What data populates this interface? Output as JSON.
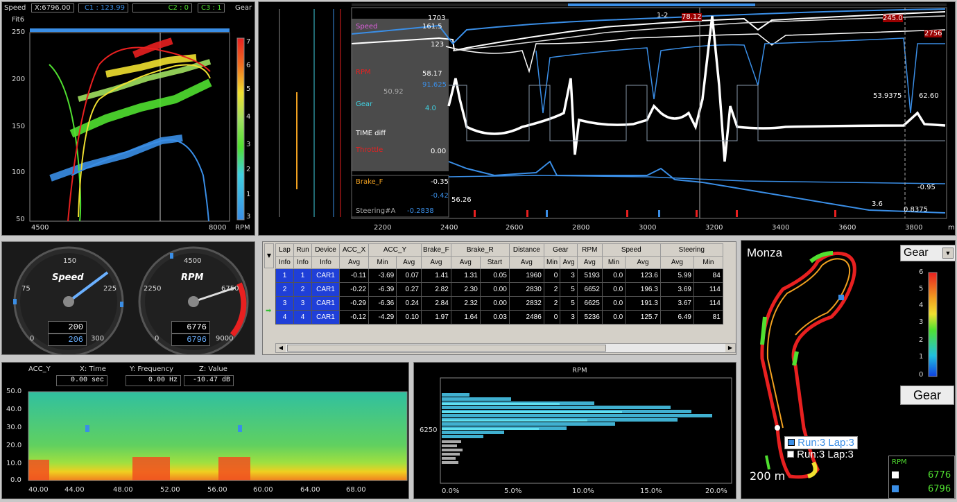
{
  "scatter": {
    "header_speed": "Speed",
    "header_x": "X:6796.00",
    "header_c1": "C1 : 123.99",
    "header_c2": "C2 : 0",
    "header_c3": "C3 : 1",
    "header_gear": "Gear",
    "header_fit": "Fit6",
    "y_ticks": [
      "250",
      "200",
      "150",
      "100",
      "50"
    ],
    "x_ticks": [
      "4500",
      "8000"
    ],
    "x_unit": "RPM",
    "gear_scale": [
      "7",
      "6",
      "5",
      "4",
      "3",
      "2",
      "1",
      "3"
    ]
  },
  "timeplot": {
    "x_ticks": [
      "2200",
      "2400",
      "2600",
      "2800",
      "3000",
      "3200",
      "3400",
      "3600",
      "3800"
    ],
    "x_unit": "m",
    "channel_labels": [
      "Speed",
      "RPM",
      "Gear",
      "TIME diff",
      "Throttle",
      "Brake_F",
      "Steering#A"
    ],
    "values": {
      "v1703": "1703",
      "v1615": "161.5",
      "v123": "123",
      "v5817": "58.17",
      "v91625": "91.625",
      "v5092": "50.92",
      "v40": "4.0",
      "v000": "0.00",
      "brake1": "-0.35",
      "brake2": "-0.42",
      "v5626": "56.26",
      "steer": "-0.2838",
      "marker": "1-2",
      "top1": "78.12",
      "right1": "245.0",
      "right2": "2756",
      "right3": "53.9375",
      "right4": "62.60",
      "right5": "-0.95",
      "right6": "0.8375",
      "right7": "3.6"
    }
  },
  "gauges": {
    "speed_title": "Speed",
    "speed_ticks": [
      "0",
      "75",
      "150",
      "225",
      "300"
    ],
    "speed_val1": "200",
    "speed_val2": "206",
    "rpm_title": "RPM",
    "rpm_ticks": [
      "0",
      "2250",
      "4500",
      "6750",
      "9000"
    ],
    "rpm_val1": "6776",
    "rpm_val2": "6796"
  },
  "table": {
    "headers1": [
      "Lap",
      "Run",
      "Device",
      "ACC_X",
      "ACC_Y",
      "Brake_F",
      "Brake_R",
      "Distance",
      "Gear",
      "RPM",
      "Speed",
      "Steering"
    ],
    "headers2": [
      "Info",
      "Info",
      "Info",
      "Avg",
      "Min",
      "Avg",
      "Avg",
      "Avg",
      "Start",
      "Avg",
      "Min",
      "Avg",
      "Avg",
      "Min",
      "Avg",
      "Avg",
      "Min"
    ],
    "rows": [
      [
        "1",
        "1",
        "CAR1",
        "-0.11",
        "-3.69",
        "0.07",
        "1.41",
        "1.31",
        "0.05",
        "1960",
        "0",
        "3",
        "5193",
        "0.0",
        "123.6",
        "5.99",
        "84"
      ],
      [
        "2",
        "2",
        "CAR1",
        "-0.22",
        "-6.39",
        "0.27",
        "2.82",
        "2.30",
        "0.00",
        "2830",
        "2",
        "5",
        "6652",
        "0.0",
        "196.3",
        "3.69",
        "114"
      ],
      [
        "3",
        "3",
        "CAR1",
        "-0.29",
        "-6.36",
        "0.24",
        "2.84",
        "2.32",
        "0.00",
        "2832",
        "2",
        "5",
        "6625",
        "0.0",
        "191.3",
        "3.67",
        "114"
      ],
      [
        "4",
        "4",
        "CAR1",
        "-0.12",
        "-4.29",
        "0.10",
        "1.97",
        "1.64",
        "0.03",
        "2486",
        "0",
        "3",
        "5236",
        "0.0",
        "125.7",
        "6.49",
        "81"
      ]
    ]
  },
  "track": {
    "name": "Monza",
    "gear_select": "Gear",
    "scale_ticks": [
      "6",
      "5",
      "4",
      "3",
      "2",
      "1",
      "0"
    ],
    "gear_button": "Gear",
    "run1": "Run:3 Lap:3",
    "run2": "Run:3 Lap:3",
    "distance": "200 m",
    "rpm_label": "RPM",
    "rpm_v1": "6776",
    "rpm_v2": "6796"
  },
  "spectro": {
    "channel": "ACC_Y",
    "x_label": "X: Time",
    "y_label": "Y: Frequency",
    "z_label": "Z: Value",
    "x_val": "0.00 sec",
    "y_val": "0.00 Hz",
    "z_val": "-10.47 dB",
    "y_ticks": [
      "50.0",
      "40.0",
      "30.0",
      "20.0",
      "10.0",
      "0.0"
    ],
    "x_ticks": [
      "40.00",
      "44.00",
      "48.00",
      "52.00",
      "56.00",
      "60.00",
      "64.00",
      "68.00"
    ]
  },
  "histogram": {
    "title": "RPM",
    "y_tick": "6250",
    "x_ticks": [
      "0.0%",
      "5.0%",
      "10.0%",
      "15.0%",
      "20.0%"
    ]
  },
  "colors": {
    "accent_blue": "#3a8ee6",
    "grid": "#303030",
    "red": "#e82020",
    "yellow": "#f0e030",
    "green": "#50e030",
    "cyan": "#40d0e0"
  }
}
